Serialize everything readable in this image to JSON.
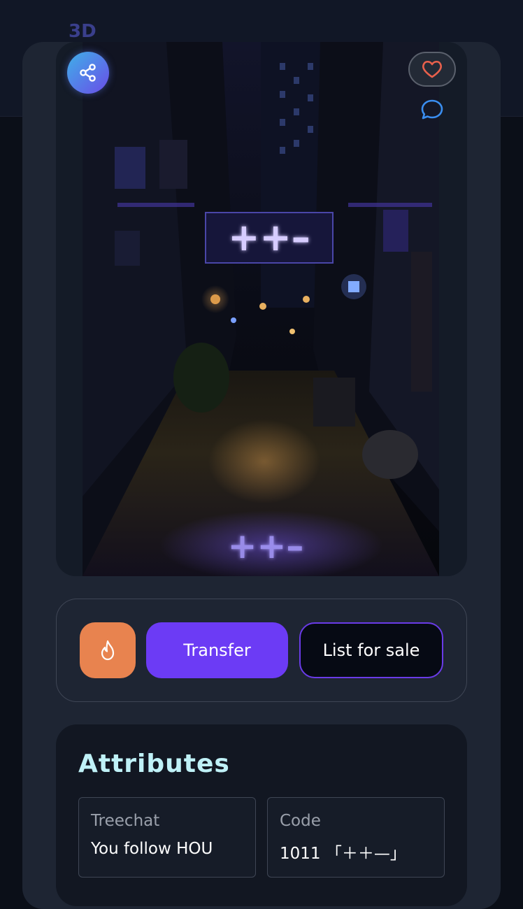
{
  "background": {
    "label": "3D"
  },
  "nft": {
    "sign_text": "++–",
    "reflection_text": "++–"
  },
  "icons": {
    "share": "share-icon",
    "like": "heart-icon",
    "comment": "chat-bubble-icon",
    "burn": "flame-icon"
  },
  "actions": {
    "transfer_label": "Transfer",
    "list_label": "List for sale"
  },
  "attributes": {
    "title": "Attributes",
    "items": [
      {
        "label": "Treechat",
        "value": "You follow HOU"
      },
      {
        "label": "Code",
        "value": "1011 「＋＋—」"
      }
    ]
  },
  "colors": {
    "accent_purple": "#6c3bf5",
    "burn_orange": "#e8834f",
    "heart_red": "#e8604c",
    "title_cyan": "#bff1f7",
    "card_bg": "#1e2533",
    "page_bg": "#0b0f18"
  }
}
